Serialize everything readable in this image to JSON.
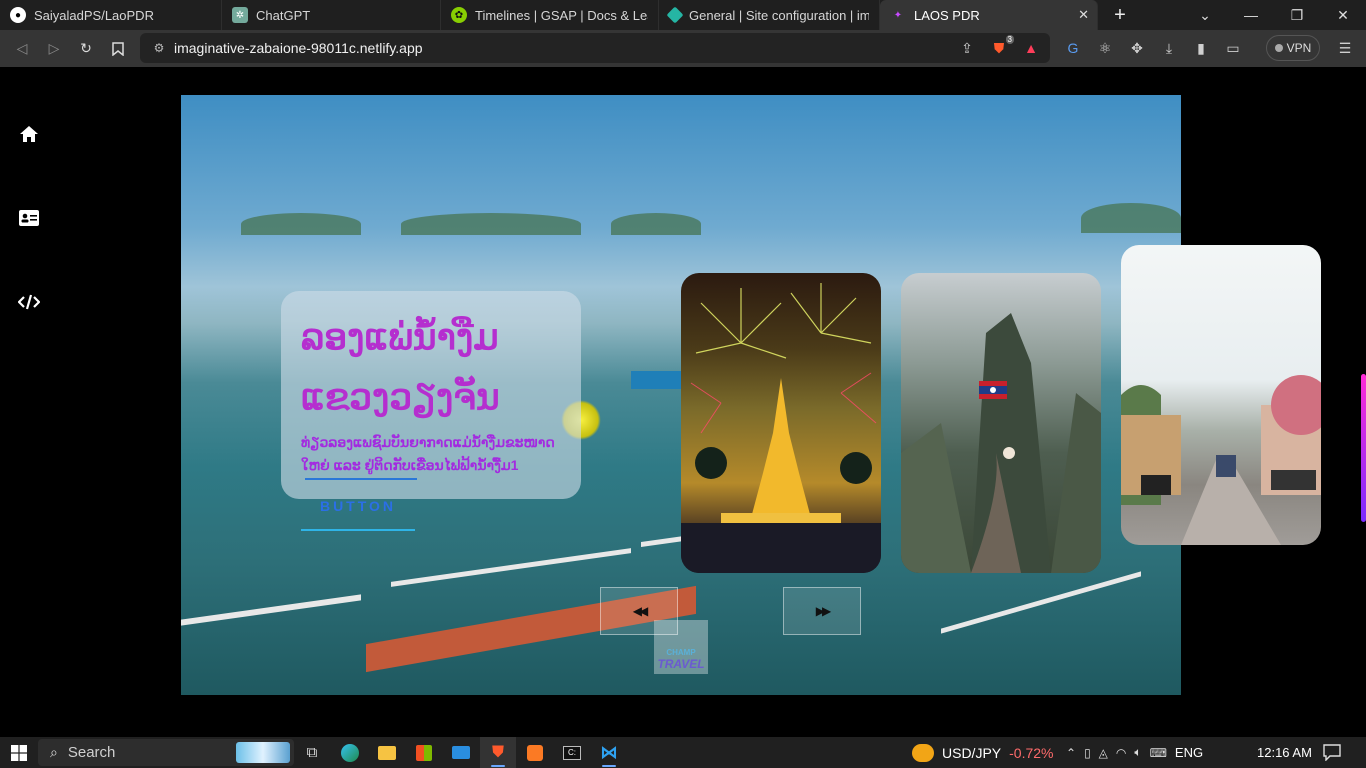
{
  "browser": {
    "tabs": [
      {
        "title": "SaiyaladPS/LaoPDR",
        "icon": "github-icon"
      },
      {
        "title": "ChatGPT",
        "icon": "chatgpt-icon"
      },
      {
        "title": "Timelines | GSAP | Docs & Learning",
        "icon": "gsap-icon"
      },
      {
        "title": "General | Site configuration | imag",
        "icon": "netlify-icon"
      },
      {
        "title": "LAOS PDR",
        "icon": "site-icon",
        "active": true
      }
    ],
    "new_tab_label": "+",
    "url": "imaginative-zabaione-98011c.netlify.app",
    "brave_badge": "3",
    "vpn_label": "VPN"
  },
  "page": {
    "sidebar": [
      {
        "name": "home",
        "icon": "home-icon"
      },
      {
        "name": "contact",
        "icon": "id-card-icon"
      },
      {
        "name": "code",
        "icon": "code-icon"
      }
    ],
    "hero": {
      "title_line1": "ລອງແພ່ນ້ຳງືມ",
      "title_line2": "ແຂວງວຽງຈັນ",
      "subtitle": "ທ່ຽວລອງແພຊົມບັນຍາກາດແມ່ນ້ຳງືມຂະໜາດໃຫຍ່ ແລະ ຢູ່ຕິດກັບເຂື່ອນໄຟຟ້ານ້ຳງື້ມ1",
      "button_label": "BUTTON"
    },
    "cards": [
      {
        "name": "fireworks-temple-card",
        "subject": "That Luang fireworks"
      },
      {
        "name": "mountain-flag-card",
        "subject": "Mountain with Lao flag"
      },
      {
        "name": "street-card",
        "subject": "Luang Prabang street"
      }
    ],
    "controls": {
      "prev_icon": "◀◀",
      "next_icon": "▶▶"
    },
    "logo": {
      "line1": "CHAMP",
      "line2": "TRAVEL"
    }
  },
  "taskbar": {
    "search_placeholder": "Search",
    "stock_name": "USD/JPY",
    "stock_change": "-0.72%",
    "language": "ENG",
    "time": "12:16 AM"
  },
  "colors": {
    "title": "#b52ecf",
    "subtitle": "#a32be0",
    "button_text": "#2b6fe6"
  }
}
